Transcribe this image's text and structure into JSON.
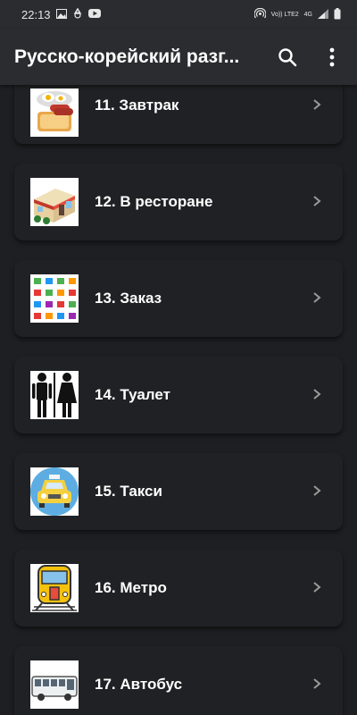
{
  "status_bar": {
    "time": "22:13",
    "icons_left": [
      "image-icon",
      "recycle-icon",
      "youtube-icon"
    ],
    "icons_right": [
      "hotspot-icon",
      "volte-icon",
      "4g-icon",
      "signal-icon",
      "battery-icon"
    ],
    "volte_text": "Vo)) LTE2",
    "net_text": "4G"
  },
  "app_bar": {
    "title": "Русско-корейский разг...",
    "search_icon": "search-icon",
    "menu_icon": "more-vert-icon"
  },
  "items": [
    {
      "label": "11. Завтрак",
      "icon": "breakfast-icon"
    },
    {
      "label": "12. В ресторане",
      "icon": "restaurant-icon"
    },
    {
      "label": "13. Заказ",
      "icon": "order-icon"
    },
    {
      "label": "14. Туалет",
      "icon": "toilet-icon"
    },
    {
      "label": "15. Такси",
      "icon": "taxi-icon"
    },
    {
      "label": "16. Метро",
      "icon": "metro-icon"
    },
    {
      "label": "17. Автобус",
      "icon": "bus-icon"
    }
  ],
  "colors": {
    "background": "#1e1f22",
    "bar": "#2b2c2f",
    "card": "#202124",
    "chevron": "#9a9a9a"
  }
}
